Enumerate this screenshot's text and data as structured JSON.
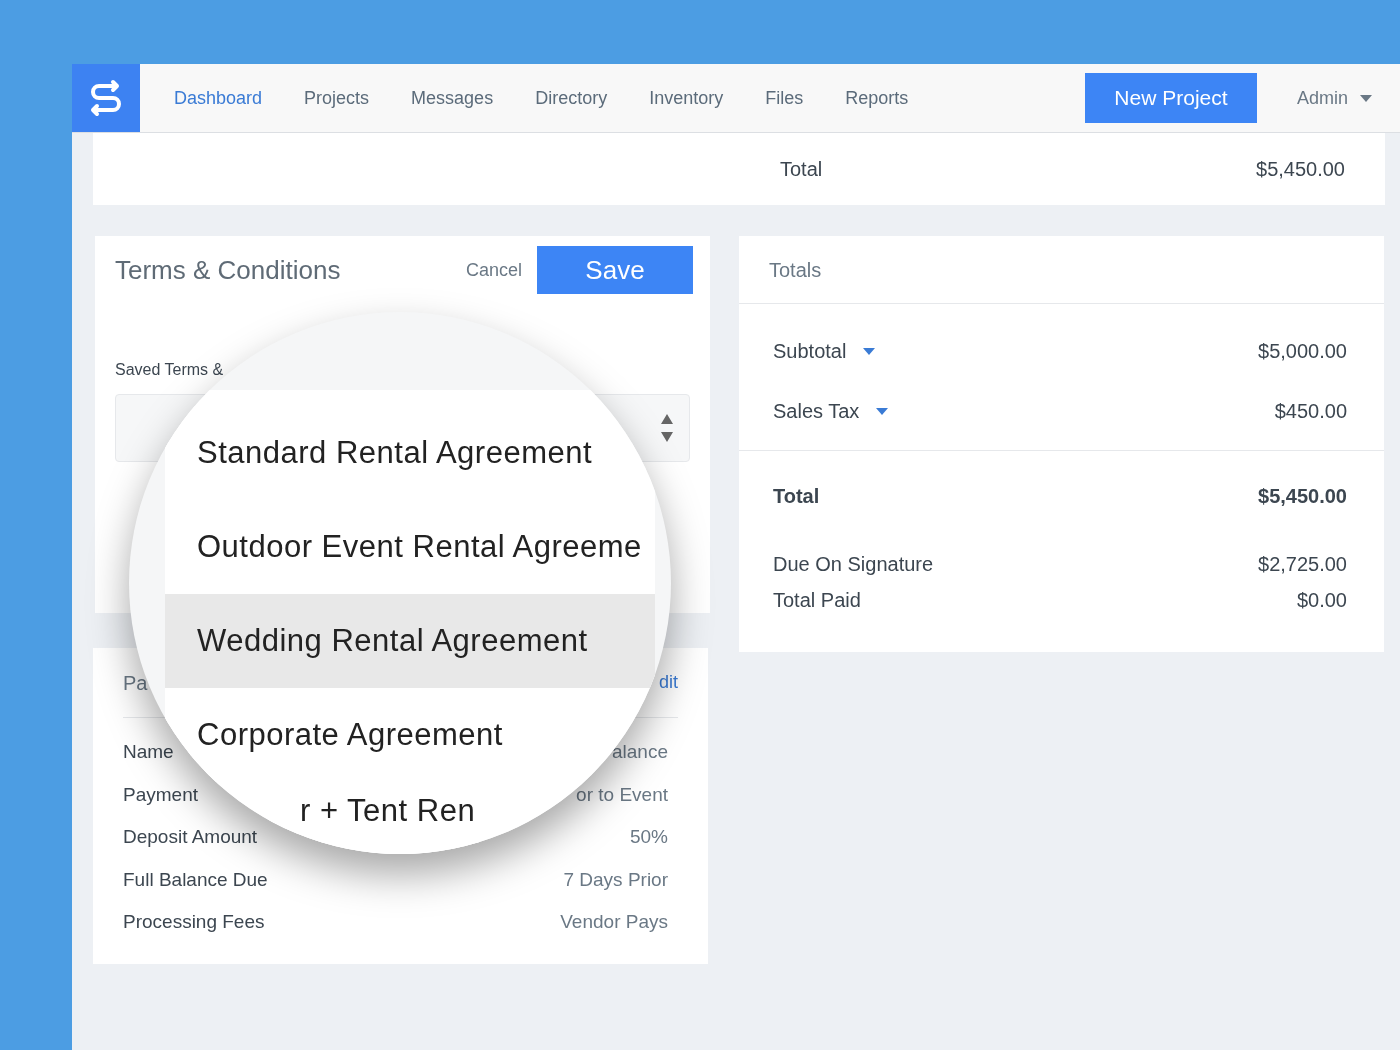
{
  "nav": {
    "items": [
      {
        "label": "Dashboard",
        "selected": true
      },
      {
        "label": "Projects",
        "selected": false
      },
      {
        "label": "Messages",
        "selected": false
      },
      {
        "label": "Directory",
        "selected": false
      },
      {
        "label": "Inventory",
        "selected": false
      },
      {
        "label": "Files",
        "selected": false
      },
      {
        "label": "Reports",
        "selected": false
      }
    ],
    "new_project_button": "New Project",
    "user_menu": "Admin"
  },
  "summary_card": {
    "label": "Total",
    "value": "$5,450.00"
  },
  "terms_panel": {
    "title": "Terms & Conditions",
    "cancel": "Cancel",
    "save": "Save",
    "field_label": "Saved Terms &"
  },
  "payment_panel": {
    "title": "Pa",
    "edit_link": "dit",
    "rows": [
      {
        "label": "Name",
        "value": "alance"
      },
      {
        "label": "Payment",
        "value": "or to Event"
      },
      {
        "label": "Deposit Amount",
        "value": "50%"
      },
      {
        "label": "Full Balance Due",
        "value": "7 Days Prior"
      },
      {
        "label": "Processing Fees",
        "value": "Vendor Pays"
      }
    ]
  },
  "totals_panel": {
    "title": "Totals",
    "lines": [
      {
        "label": "Subtotal",
        "value": "$5,000.00"
      },
      {
        "label": "Sales Tax",
        "value": "$450.00"
      }
    ],
    "total": {
      "label": "Total",
      "value": "$5,450.00"
    },
    "payments": [
      {
        "label": "Due On Signature",
        "value": "$2,725.00"
      },
      {
        "label": "Total Paid",
        "value": "$0.00"
      }
    ]
  },
  "magnifier": {
    "options": [
      {
        "label": "Standard Rental Agreement",
        "selected": false
      },
      {
        "label": "Outdoor Event Rental Agreeme",
        "selected": false
      },
      {
        "label": "Wedding Rental Agreement",
        "selected": true
      },
      {
        "label": "Corporate Agreement",
        "selected": false
      },
      {
        "label": "r + Tent Ren",
        "selected": false
      }
    ]
  }
}
